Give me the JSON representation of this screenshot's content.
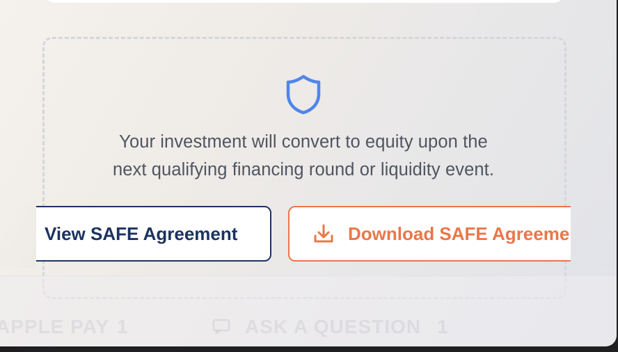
{
  "notice": {
    "icon": "shield-icon",
    "line1": "Your investment will convert to equity upon the",
    "line2": "next qualifying financing round or liquidity event."
  },
  "actions": {
    "view_label": "View SAFE Agreement",
    "download_label": "Download SAFE Agreement",
    "download_icon": "download-icon"
  },
  "bottom_tabs": {
    "left_label": "APPLE PAY",
    "left_count": "1",
    "right_icon": "chat-icon",
    "right_label": "ASK A QUESTION",
    "right_count": "1"
  },
  "colors": {
    "shield": "#4f86ea",
    "view_button": "#1c3360",
    "download_button": "#e9774a",
    "text": "#4f5560"
  }
}
